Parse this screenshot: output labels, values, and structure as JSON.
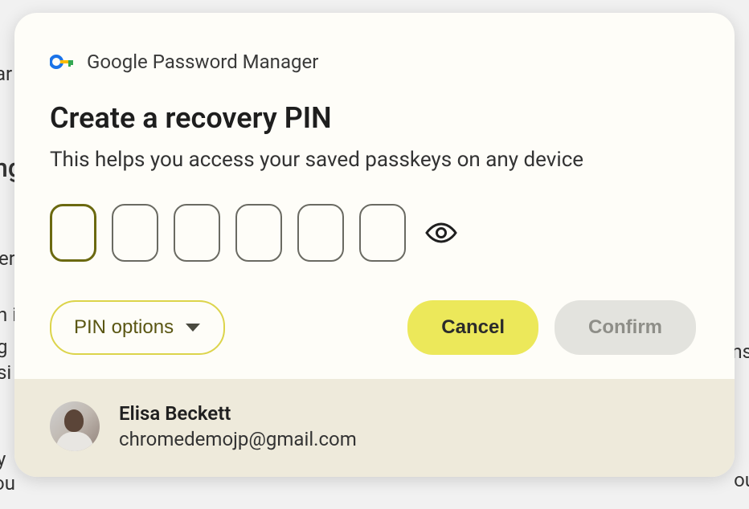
{
  "app": {
    "name": "Google Password Manager"
  },
  "dialog": {
    "title": "Create a recovery PIN",
    "subtitle": "This helps you access your saved passkeys on any device",
    "pin_boxes": 6,
    "active_index": 0
  },
  "pin_options": {
    "label": "PIN options"
  },
  "buttons": {
    "cancel": "Cancel",
    "confirm": "Confirm"
  },
  "user": {
    "name": "Elisa Beckett",
    "email": "chromedemojp@gmail.com"
  },
  "background_fragments": {
    "b1": "ar",
    "b2": "ng",
    "b3": "er",
    "b4": "n i",
    "b5": "g",
    "b6": "si",
    "b7": "y",
    "b8": "ou",
    "b9": "ns",
    "b10": "ou"
  }
}
